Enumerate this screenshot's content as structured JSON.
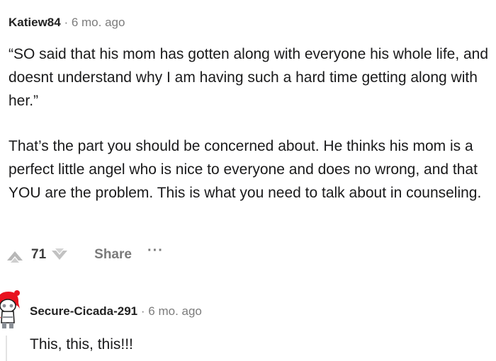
{
  "comment": {
    "username": "Katiew84",
    "separator": "·",
    "age": "6 mo. ago",
    "paragraphs": [
      "“SO said that his mom has gotten along with everyone his whole life, and doesnt understand why I am having such a hard time getting along with her.”",
      "That’s the part you should be concerned about. He thinks his mom is a perfect little angel who is nice to everyone and does no wrong, and that YOU are the problem. This is what you need to talk about in counseling."
    ],
    "score": "71",
    "share_label": "Share",
    "more_label": "···",
    "icons": [
      "upvote-icon",
      "downvote-icon",
      "more-icon"
    ]
  },
  "reply": {
    "username": "Secure-Cicada-291",
    "separator": "·",
    "age": "6 mo. ago",
    "text": "This, this, this!!!",
    "avatar_icon": "snoo-avatar-icon",
    "avatar_colors": {
      "hair": "#e8131f",
      "skin": "#ffffff",
      "eye": "#8a8f96"
    }
  }
}
